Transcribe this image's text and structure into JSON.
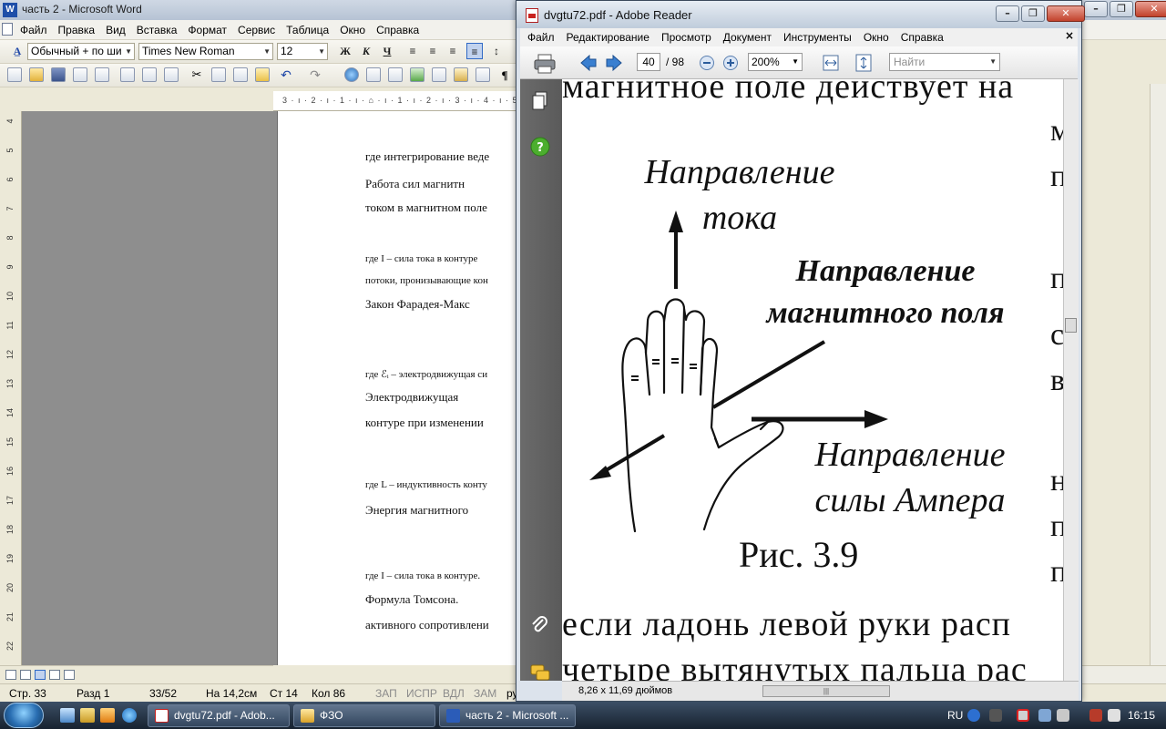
{
  "word": {
    "title": "часть 2 - Microsoft Word",
    "menu": [
      "Файл",
      "Правка",
      "Вид",
      "Вставка",
      "Формат",
      "Сервис",
      "Таблица",
      "Окно",
      "Справка"
    ],
    "style_combo": "Обычный + по ши",
    "font_combo": "Times New Roman",
    "size_combo": "12",
    "bold": "Ж",
    "italic": "К",
    "underline": "Ч",
    "ruler_ticks": "3 · ı · 2 · ı · 1 · ı · ⌂ · ı · 1 · ı · 2 · ı · 3 · ı · 4 · ı · 5 · ı · 6 · ı · 7 · ı · 8 · ı · 9 · ı · ¶",
    "vruler": [
      "4",
      "5",
      "6",
      "7",
      "8",
      "9",
      "10",
      "11",
      "12",
      "13",
      "14",
      "15",
      "16",
      "17",
      "18",
      "19",
      "20",
      "21",
      "22"
    ],
    "doc_lines": [
      {
        "text": "где интегрирование веде",
        "small": false
      },
      {
        "text": "       Работа сил магнитн",
        "small": false
      },
      {
        "text": "током в магнитном поле",
        "small": false
      },
      {
        "text": "где I – сила тока в контуре",
        "small": true
      },
      {
        "text": "потоки, пронизывающие кон",
        "small": true
      },
      {
        "text": "       Закон Фарадея-Макс",
        "small": false
      },
      {
        "text": "где ℰᵢ – электродвижущая си",
        "small": true
      },
      {
        "text": "       Электродвижущая",
        "small": false
      },
      {
        "text": "контуре при изменении",
        "small": false
      },
      {
        "text": "где L – индуктивность конту",
        "small": true
      },
      {
        "text": "       Энергия магнитного",
        "small": false
      },
      {
        "text": "где I – сила тока в контуре.",
        "small": true
      },
      {
        "text": "       Формула   Томсона.",
        "small": false
      },
      {
        "text": "активного сопротивлени",
        "small": false
      }
    ],
    "status": {
      "page": "Стр. 33",
      "section": "Разд 1",
      "pages": "33/52",
      "position": "На 14,2см",
      "line": "Ст 14",
      "col": "Кол 86",
      "rec": "ЗАП",
      "trk": "ИСПР",
      "ext": "ВДЛ",
      "ovr": "ЗАМ",
      "lang": "ру"
    }
  },
  "reader": {
    "title": "dvgtu72.pdf - Adobe Reader",
    "menu": [
      "Файл",
      "Редактирование",
      "Просмотр",
      "Документ",
      "Инструменты",
      "Окно",
      "Справка"
    ],
    "page_current": "40",
    "page_total": "/ 98",
    "zoom": "200%",
    "find_placeholder": "Найти",
    "page_size": "8,26 x 11,69 дюймов",
    "pdf_text": {
      "top_line": "магнитное поле действует на",
      "label_current_1": "Направление",
      "label_current_2": "тока",
      "label_field_1": "Направление",
      "label_field_2": "магнитного поля",
      "label_force_1": "Направление",
      "label_force_2": "силы Ампера",
      "caption": "Рис.  3.9",
      "bottom_line_1": "если  ладонь  левой  руки  расп",
      "bottom_line_2": "четыре  вытянутых  пальца  рас",
      "right_edge_chars": [
        "м",
        "п",
        "п",
        "с",
        "в",
        "н",
        "п",
        "п"
      ]
    }
  },
  "taskbar": {
    "tasks": [
      "dvgtu72.pdf - Adob...",
      "ФЗО",
      "часть 2 - Microsoft ..."
    ],
    "lang": "RU",
    "time": "16:15"
  },
  "colors": {
    "taskbar_top": "#3c4f66",
    "taskbar_bottom": "#17222f",
    "workspace": "#8e8e8e",
    "nav_panel": "#5a5a5a",
    "close_red": "#c2412b"
  }
}
